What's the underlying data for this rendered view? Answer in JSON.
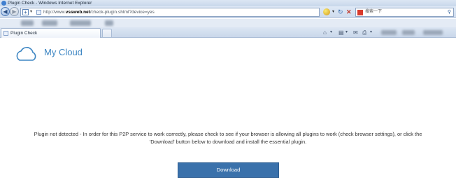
{
  "window": {
    "title": "Plugin Check - Windows Internet Explorer"
  },
  "address_bar": {
    "url_prefix": "http://www.",
    "url_domain": "vssweb.net",
    "url_path": "/check-plugin.shtml?device=yes"
  },
  "search": {
    "text": "搜索一下"
  },
  "tab": {
    "label": "Plugin Check"
  },
  "page": {
    "brand_name": "My Cloud",
    "message_line1": "Plugin not detected - In order for this P2P service to work correctly, please check to see if your browser is allowing all plugins to work (check browser settings), or click the",
    "message_line2": "'Download' button below to download and install the essential plugin.",
    "download_label": "Download"
  },
  "colors": {
    "brand": "#3d86c3",
    "button": "#3a71ab",
    "text": "#333333"
  },
  "icons": [
    "ie-icon",
    "back-icon",
    "forward-icon",
    "add-icon",
    "page-icon",
    "compatibility-icon",
    "refresh-icon",
    "stop-icon",
    "search-icon",
    "home-icon",
    "feeds-icon",
    "mail-icon",
    "print-icon",
    "cloud-icon"
  ]
}
